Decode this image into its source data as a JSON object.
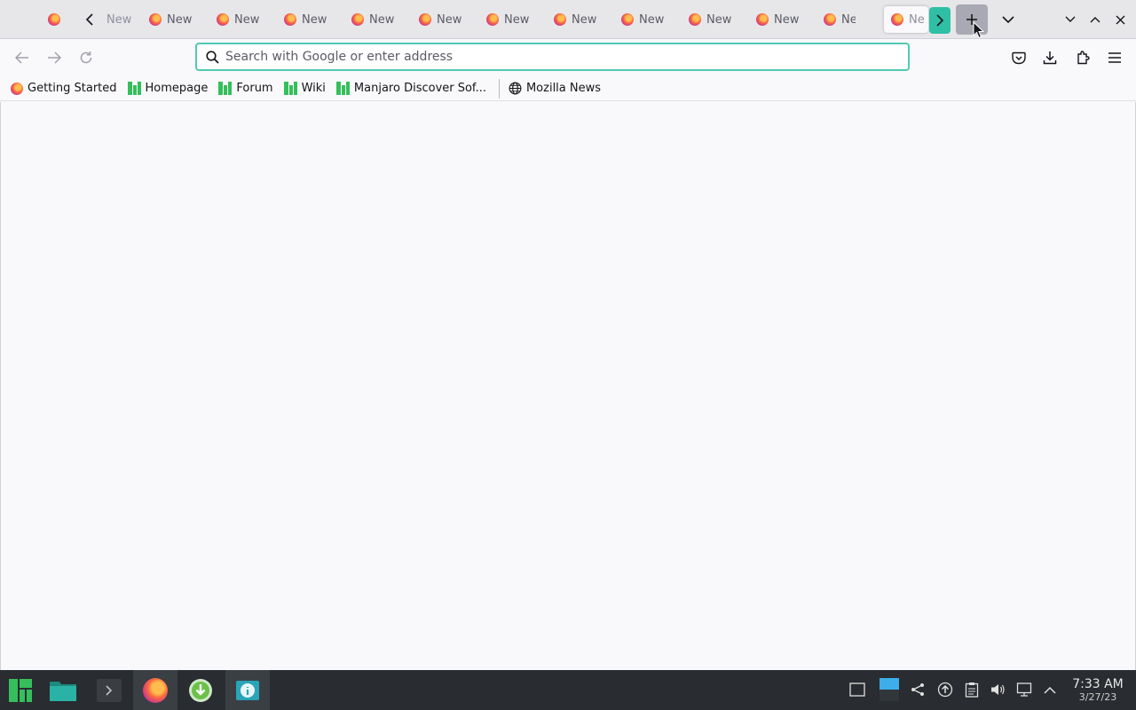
{
  "tabs": {
    "first_label": "New",
    "labels": [
      "New",
      "New",
      "New",
      "New",
      "New",
      "New",
      "New",
      "New",
      "New",
      "New",
      "New"
    ],
    "active_label": "Ne"
  },
  "navbar": {
    "search_placeholder": "Search with Google or enter address",
    "accent_color": "#2ebfa5"
  },
  "bookmarks": [
    {
      "label": "Getting Started",
      "icon": "firefox-icon"
    },
    {
      "label": "Homepage",
      "icon": "manjaro-icon"
    },
    {
      "label": "Forum",
      "icon": "manjaro-icon"
    },
    {
      "label": "Wiki",
      "icon": "manjaro-icon"
    },
    {
      "label": "Manjaro Discover Sof...",
      "icon": "manjaro-icon"
    },
    {
      "label": "Mozilla News",
      "icon": "globe-icon"
    }
  ],
  "taskbar": {
    "time": "7:33 AM",
    "date": "3/27/23"
  }
}
